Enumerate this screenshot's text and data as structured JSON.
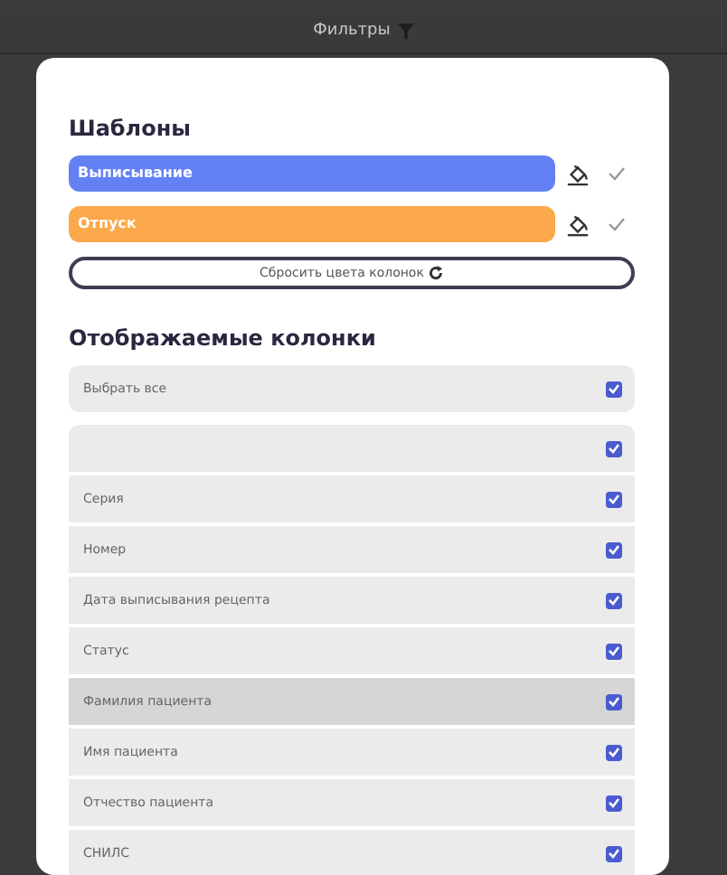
{
  "top_bar": {
    "title": "Фильтры"
  },
  "templates": {
    "heading": "Шаблоны",
    "items": [
      {
        "label": "Выписывание",
        "color": "#6381f5"
      },
      {
        "label": "Отпуск",
        "color": "#fba94b"
      }
    ],
    "reset_button": "Сбросить цвета колонок"
  },
  "columns": {
    "heading": "Отображаемые колонки",
    "select_all": {
      "label": "Выбрать все",
      "checked": true
    },
    "items": [
      {
        "checked": true,
        "highlighted": false
      },
      {
        "label": "Серия",
        "checked": true,
        "highlighted": false
      },
      {
        "label": "Номер",
        "checked": true,
        "highlighted": false
      },
      {
        "label": "Дата выписывания рецепта",
        "checked": true,
        "highlighted": false
      },
      {
        "label": "Статус",
        "checked": true,
        "highlighted": false
      },
      {
        "label": "Фамилия пациента",
        "checked": true,
        "highlighted": true
      },
      {
        "label": "Имя пациента",
        "checked": true,
        "highlighted": false
      },
      {
        "label": "Отчество пациента",
        "checked": true,
        "highlighted": false
      },
      {
        "label": "СНИЛС",
        "checked": true,
        "highlighted": false
      }
    ]
  }
}
